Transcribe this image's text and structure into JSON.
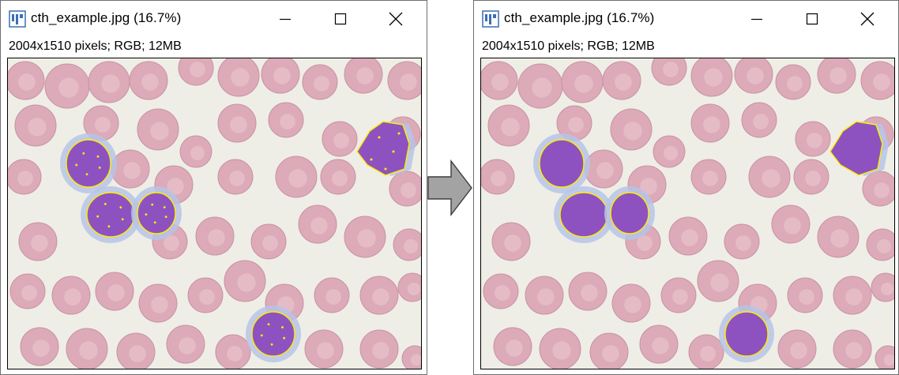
{
  "windows": [
    {
      "title": "cth_example.jpg (16.7%)",
      "info": "2004x1510 pixels; RGB; 12MB",
      "image_name": "blood-smear-with-selection-outlines"
    },
    {
      "title": "cth_example.jpg (16.7%)",
      "info": "2004x1510 pixels; RGB; 12MB",
      "image_name": "blood-smear-with-selection-outlines"
    }
  ],
  "controls": {
    "minimize": "minimize-icon",
    "maximize": "maximize-icon",
    "close": "close-icon"
  },
  "colors": {
    "background": "#eeeee6",
    "red_cell": "#dcaab8",
    "red_cell_center": "#e8c3cc",
    "nucleus": "#8e52c0",
    "cytoplasm": "#b6c4e6",
    "outline": "#ffee00",
    "arrow_fill": "#a3a3a3"
  },
  "arrow_icon": "right-arrow-icon"
}
